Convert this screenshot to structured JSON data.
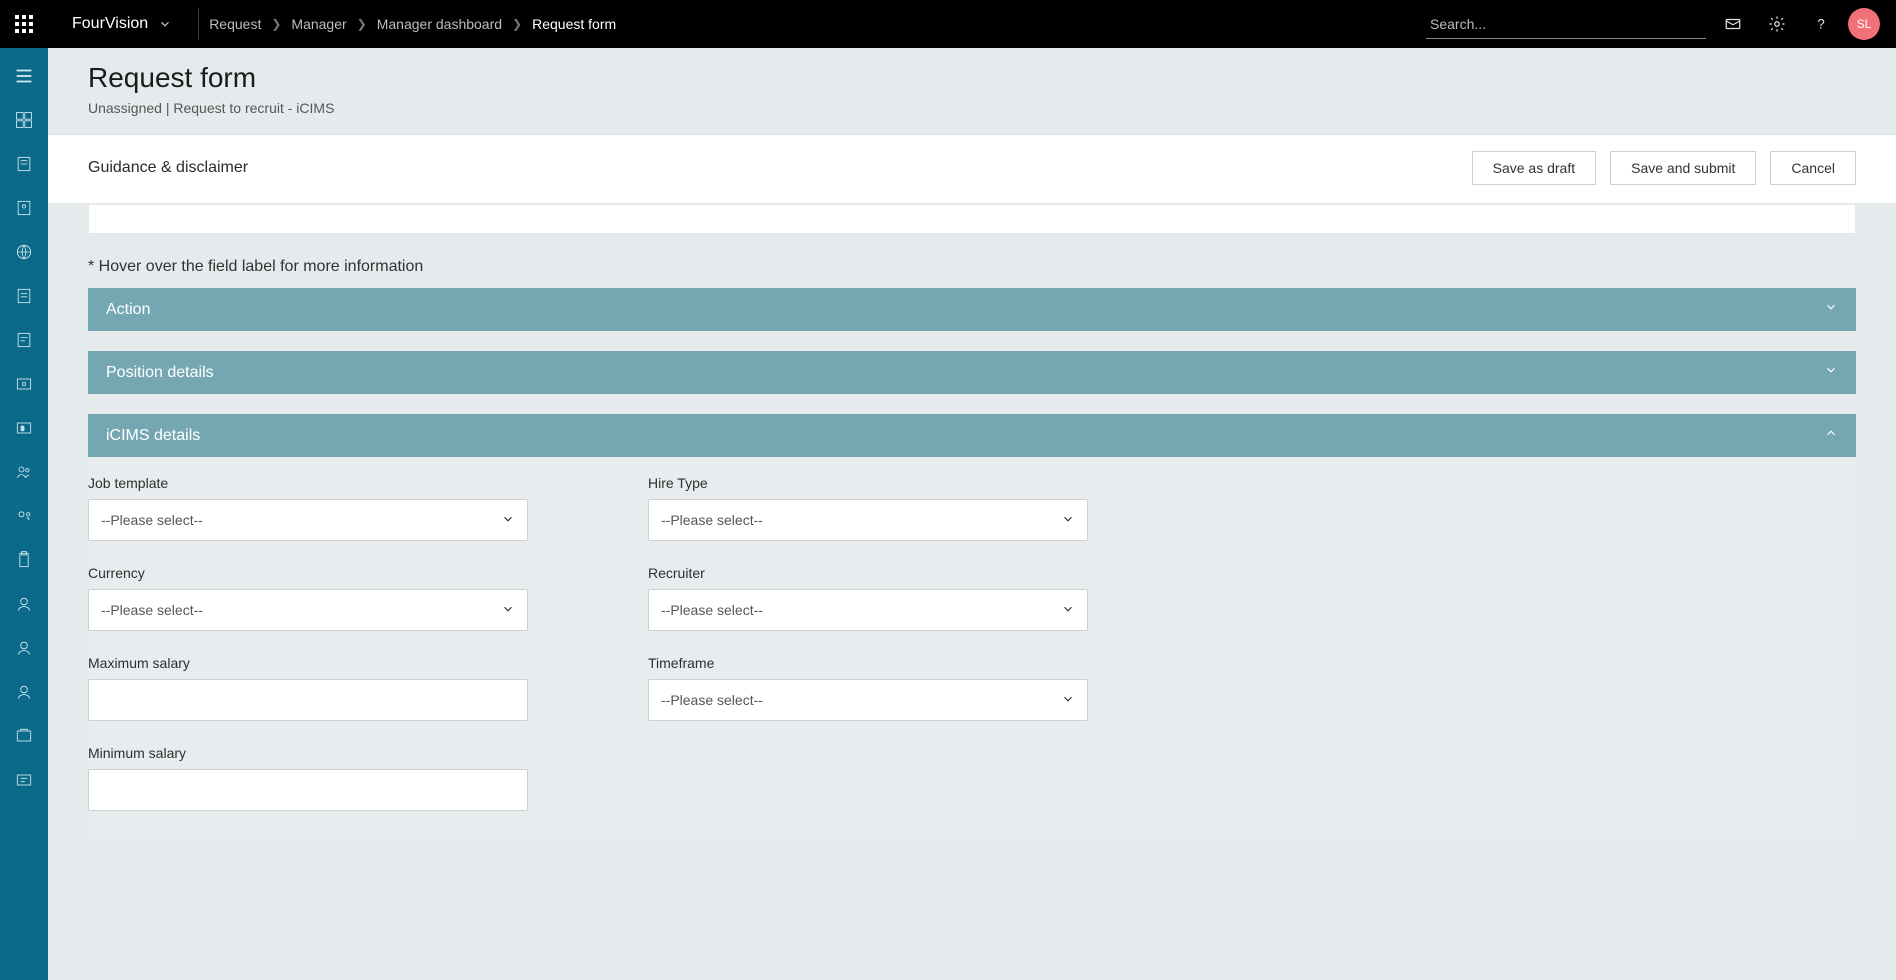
{
  "header": {
    "company": "FourVision",
    "breadcrumbs": [
      "Request",
      "Manager",
      "Manager dashboard",
      "Request form"
    ],
    "search_placeholder": "Search...",
    "avatar_initials": "SL"
  },
  "page": {
    "title": "Request form",
    "subtitle": "Unassigned | Request to recruit - iCIMS",
    "guidance_label": "Guidance & disclaimer",
    "buttons": {
      "save_draft": "Save as draft",
      "save_submit": "Save and submit",
      "cancel": "Cancel"
    },
    "hint": "* Hover over the field label for more information"
  },
  "panels": {
    "action": {
      "title": "Action",
      "expanded": false
    },
    "position_details": {
      "title": "Position details",
      "expanded": false
    },
    "icims": {
      "title": "iCIMS details",
      "expanded": true
    }
  },
  "icims_fields": {
    "job_template": {
      "label": "Job template",
      "value": "--Please select--"
    },
    "hire_type": {
      "label": "Hire Type",
      "value": "--Please select--"
    },
    "currency": {
      "label": "Currency",
      "value": "--Please select--"
    },
    "recruiter": {
      "label": "Recruiter",
      "value": "--Please select--"
    },
    "max_salary": {
      "label": "Maximum salary",
      "value": ""
    },
    "timeframe": {
      "label": "Timeframe",
      "value": "--Please select--"
    },
    "min_salary": {
      "label": "Minimum salary",
      "value": ""
    }
  }
}
